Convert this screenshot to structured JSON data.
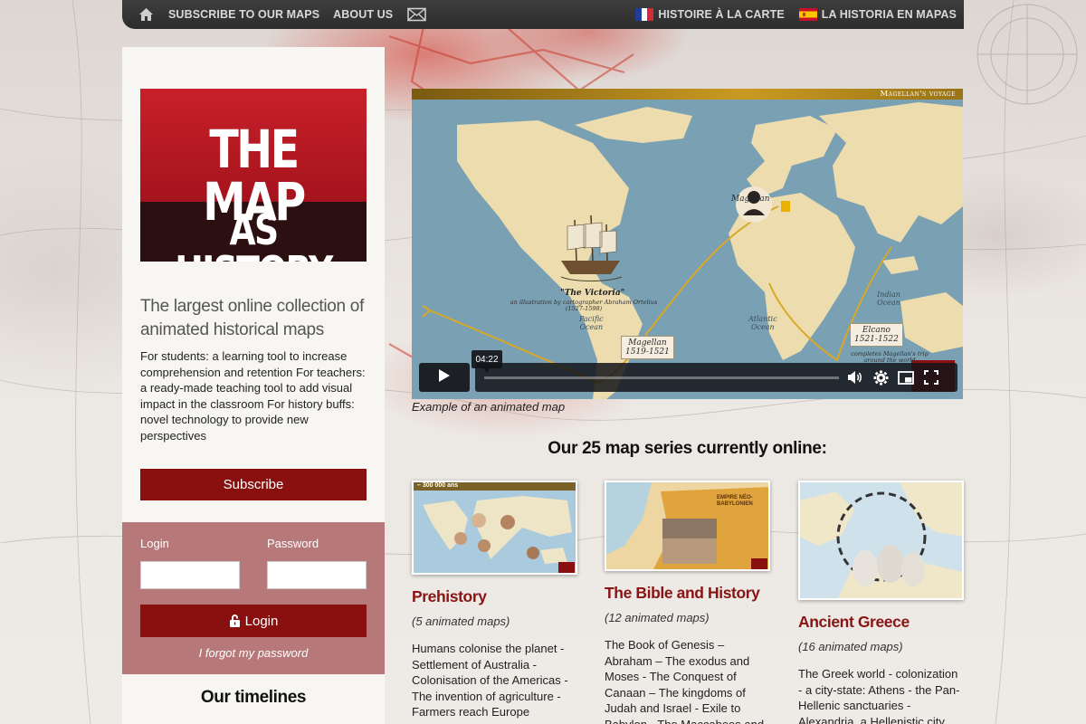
{
  "topbar": {
    "nav": [
      "SUBSCRIBE TO OUR MAPS",
      "ABOUT US"
    ],
    "languages": [
      {
        "flag": "fr",
        "label": "HISTOIRE À LA CARTE"
      },
      {
        "flag": "es",
        "label": "LA HISTORIA EN MAPAS"
      }
    ]
  },
  "sidebar": {
    "logo_line1": "THE MAP",
    "logo_line2": "AS HISTORY",
    "tagline": "The largest online collection of animated historical maps",
    "intro": "For students: a learning tool to increase comprehension and retention For teachers: a ready-made teaching tool to add visual impact in the classroom For history buffs: novel technology to provide new perspectives",
    "subscribe_label": "Subscribe",
    "login_label": "Login",
    "password_label": "Password",
    "login_button": "Login",
    "forgot_label": "I forgot my password",
    "timelines_title": "Our timelines"
  },
  "video": {
    "title": "Magellan's voyage",
    "map_labels": {
      "magellan_portrait": "Magellan",
      "pacific": "Pacific\nOcean",
      "atlantic": "Atlantic\nOcean",
      "indian": "Indian\nOcean",
      "victoria": "\"The Victoria\"",
      "victoria_note": "an illustration by cartographer Abraham Ortelius (1527-1598)",
      "magellan_tag": "Magellan\n1519-1521",
      "elcano_tag": "Elcano\n1521-1522",
      "elcano_note": "completes Magellan's trip\naround the world"
    },
    "time": "04:22",
    "caption": "Example of an animated map"
  },
  "series": {
    "heading": "Our 25 map series currently online:",
    "cards": [
      {
        "title": "Prehistory",
        "count": "(5 animated maps)",
        "desc": "Humans colonise the planet - Settlement of Australia - Colonisation of the Americas - The invention of agriculture - Farmers reach Europe",
        "thumb_label": "– 300 000 ans"
      },
      {
        "title": "The Bible and History",
        "count": "(12 animated maps)",
        "desc": "The Book of Genesis – Abraham – The exodus and Moses - The Conquest of Canaan – The kingdoms of Judah and Israel - Exile to Babylon - The Maccabees and",
        "thumb_label": "EMPIRE NÉO-BABYLONIEN"
      },
      {
        "title": "Ancient Greece",
        "count": "(16 animated maps)",
        "desc": "The Greek world - colonization - a city-state: Athens - the Pan-Hellenic sanctuaries - Alexandria, a Hellenistic city"
      }
    ]
  },
  "colors": {
    "accent": "#8a1010",
    "login_panel": "#b67878",
    "topbar": "#333333",
    "title_red": "#8a1414"
  }
}
